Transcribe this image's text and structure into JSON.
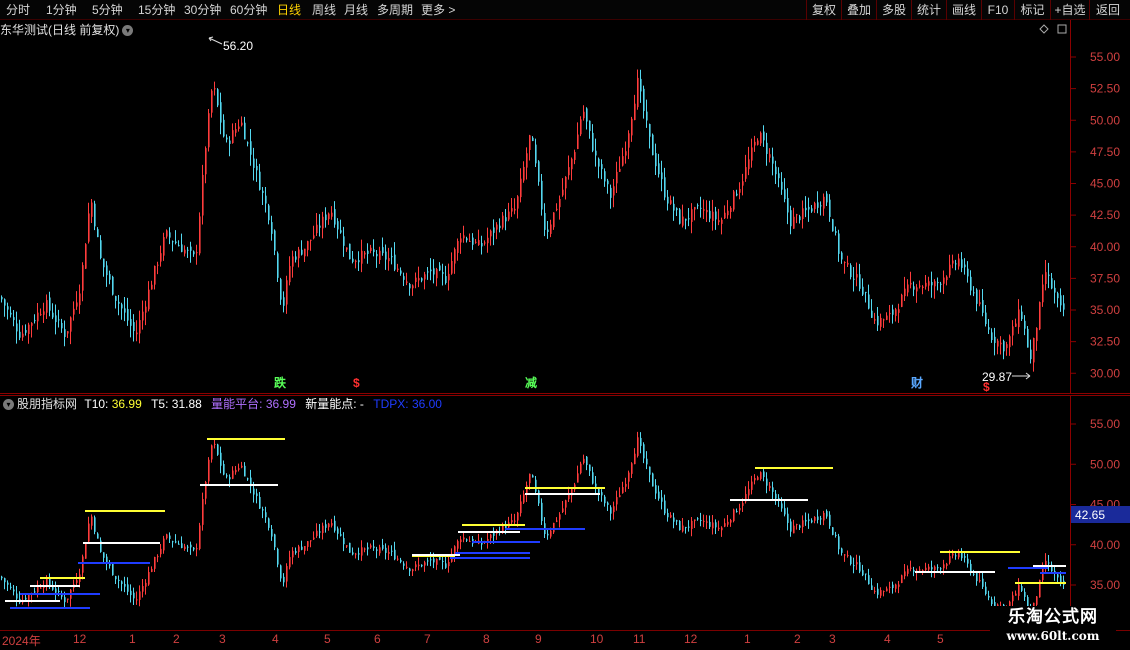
{
  "toolbar": {
    "periods": [
      "分时",
      "1分钟",
      "5分钟",
      "15分钟",
      "30分钟",
      "60分钟",
      "日线",
      "周线",
      "月线",
      "多周期",
      "更多 >"
    ],
    "active_period": "日线",
    "right_buttons": [
      "复权",
      "叠加",
      "多股",
      "统计",
      "画线",
      "F10",
      "标记",
      "+自选",
      "返回"
    ]
  },
  "main_pane": {
    "title": "东华测试(日线 前复权)",
    "high_marker": "56.20",
    "low_marker": "29.87",
    "events": [
      {
        "label": "跌",
        "color": "#58ff58"
      },
      {
        "label": "$",
        "color": "#ff3030"
      },
      {
        "label": "减",
        "color": "#58ff58"
      },
      {
        "label": "财",
        "color": "#5aa8ff"
      },
      {
        "label": "$",
        "color": "#ff3030"
      }
    ],
    "axis_labels": [
      "55.00",
      "52.50",
      "50.00",
      "47.50",
      "45.00",
      "42.50",
      "40.00",
      "37.50",
      "35.00",
      "32.50",
      "30.00"
    ]
  },
  "indicator_pane": {
    "name": "股朋指标网",
    "t10_label": "T10:",
    "t10_value": "36.99",
    "t5_label": "T5:",
    "t5_value": "31.88",
    "platform_label": "量能平台:",
    "platform_value": "36.99",
    "new_point_label": "新量能点:",
    "new_point_value": "-",
    "tdpx_label": "TDPX:",
    "tdpx_value": "36.00",
    "axis_labels": [
      "55.00",
      "50.00",
      "45.00",
      "40.00",
      "35.00"
    ],
    "current_price": "42.65"
  },
  "date_axis": [
    "2024年",
    "12",
    "1",
    "2",
    "3",
    "4",
    "5",
    "6",
    "7",
    "8",
    "9",
    "10",
    "11",
    "12",
    "1",
    "2",
    "3",
    "4",
    "5"
  ],
  "watermark": {
    "title": "乐淘公式网",
    "url": "www.60lt.com"
  },
  "colors": {
    "up": "#ff3c3c",
    "down": "#54d8f0",
    "yellow_line": "#ffff33",
    "white_line": "#ffffff",
    "blue_line": "#1f3cff",
    "frame": "#8b0000",
    "active_period": "#ffd200"
  },
  "icons": [
    "dropdown-circle-icon",
    "diamond-icon",
    "window-icon",
    "arrow-icon"
  ]
}
